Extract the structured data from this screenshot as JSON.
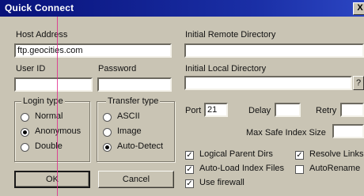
{
  "window": {
    "title": "Quick Connect",
    "close_glyph": "X"
  },
  "host": {
    "label": "Host Address",
    "value": "ftp.geocities.com"
  },
  "user": {
    "label": "User ID",
    "value": ""
  },
  "password": {
    "label": "Password",
    "value": ""
  },
  "login_type": {
    "label": "Login type",
    "options": [
      "Normal",
      "Anonymous",
      "Double"
    ],
    "selected": "Anonymous"
  },
  "transfer_type": {
    "label": "Transfer type",
    "options": [
      "ASCII",
      "Image",
      "Auto-Detect"
    ],
    "selected": "Auto-Detect"
  },
  "remote_dir": {
    "label": "Initial Remote Directory",
    "value": ""
  },
  "local_dir": {
    "label": "Initial Local Directory",
    "value": "",
    "help_glyph": "?"
  },
  "port": {
    "label": "Port",
    "value": "21"
  },
  "delay": {
    "label": "Delay",
    "value": ""
  },
  "retry": {
    "label": "Retry",
    "value": ""
  },
  "max_index": {
    "label": "Max Safe Index Size",
    "value": ""
  },
  "checkboxes": {
    "logical_parent_dirs": {
      "label": "Logical Parent Dirs",
      "checked": true
    },
    "resolve_links": {
      "label": "Resolve Links",
      "checked": true
    },
    "auto_load_index": {
      "label": "Auto-Load Index Files",
      "checked": true
    },
    "auto_rename": {
      "label": "AutoRename",
      "checked": false
    },
    "use_firewall": {
      "label": "Use firewall",
      "checked": true
    }
  },
  "buttons": {
    "ok": "OK",
    "cancel": "Cancel"
  },
  "check_glyph": "✓"
}
